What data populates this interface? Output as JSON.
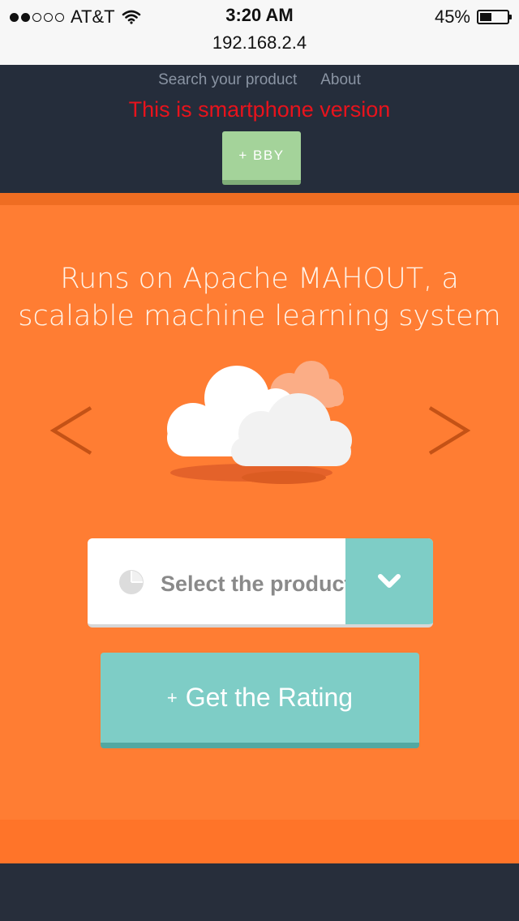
{
  "status_bar": {
    "carrier": "AT&T",
    "time": "3:20 AM",
    "url": "192.168.2.4",
    "battery": "45%",
    "battery_level": 0.45,
    "signal_bars_filled": 2,
    "signal_bars_total": 5
  },
  "nav": {
    "links": [
      "Search your product",
      "About"
    ],
    "notice": "This is smartphone version",
    "notice_color": "#e8131c",
    "bby_button": "+ BBY"
  },
  "hero": {
    "tagline_line1": "Runs on Apache MAHOUT, a",
    "tagline_line2": "scalable machine learning system",
    "prev_icon": "chevron-left-icon",
    "next_icon": "chevron-right-icon",
    "illustration_icon": "cloud-icon"
  },
  "product_select": {
    "placeholder": "Select the product",
    "icon": "pie-chart-icon",
    "toggle_icon": "chevron-down-icon"
  },
  "rating_button": {
    "plus": "+",
    "label": "Get the Rating"
  },
  "colors": {
    "nav_bg": "#252d3b",
    "orange": "#ff7d33",
    "teal": "#7ecdc6",
    "green": "#a4d39a"
  }
}
